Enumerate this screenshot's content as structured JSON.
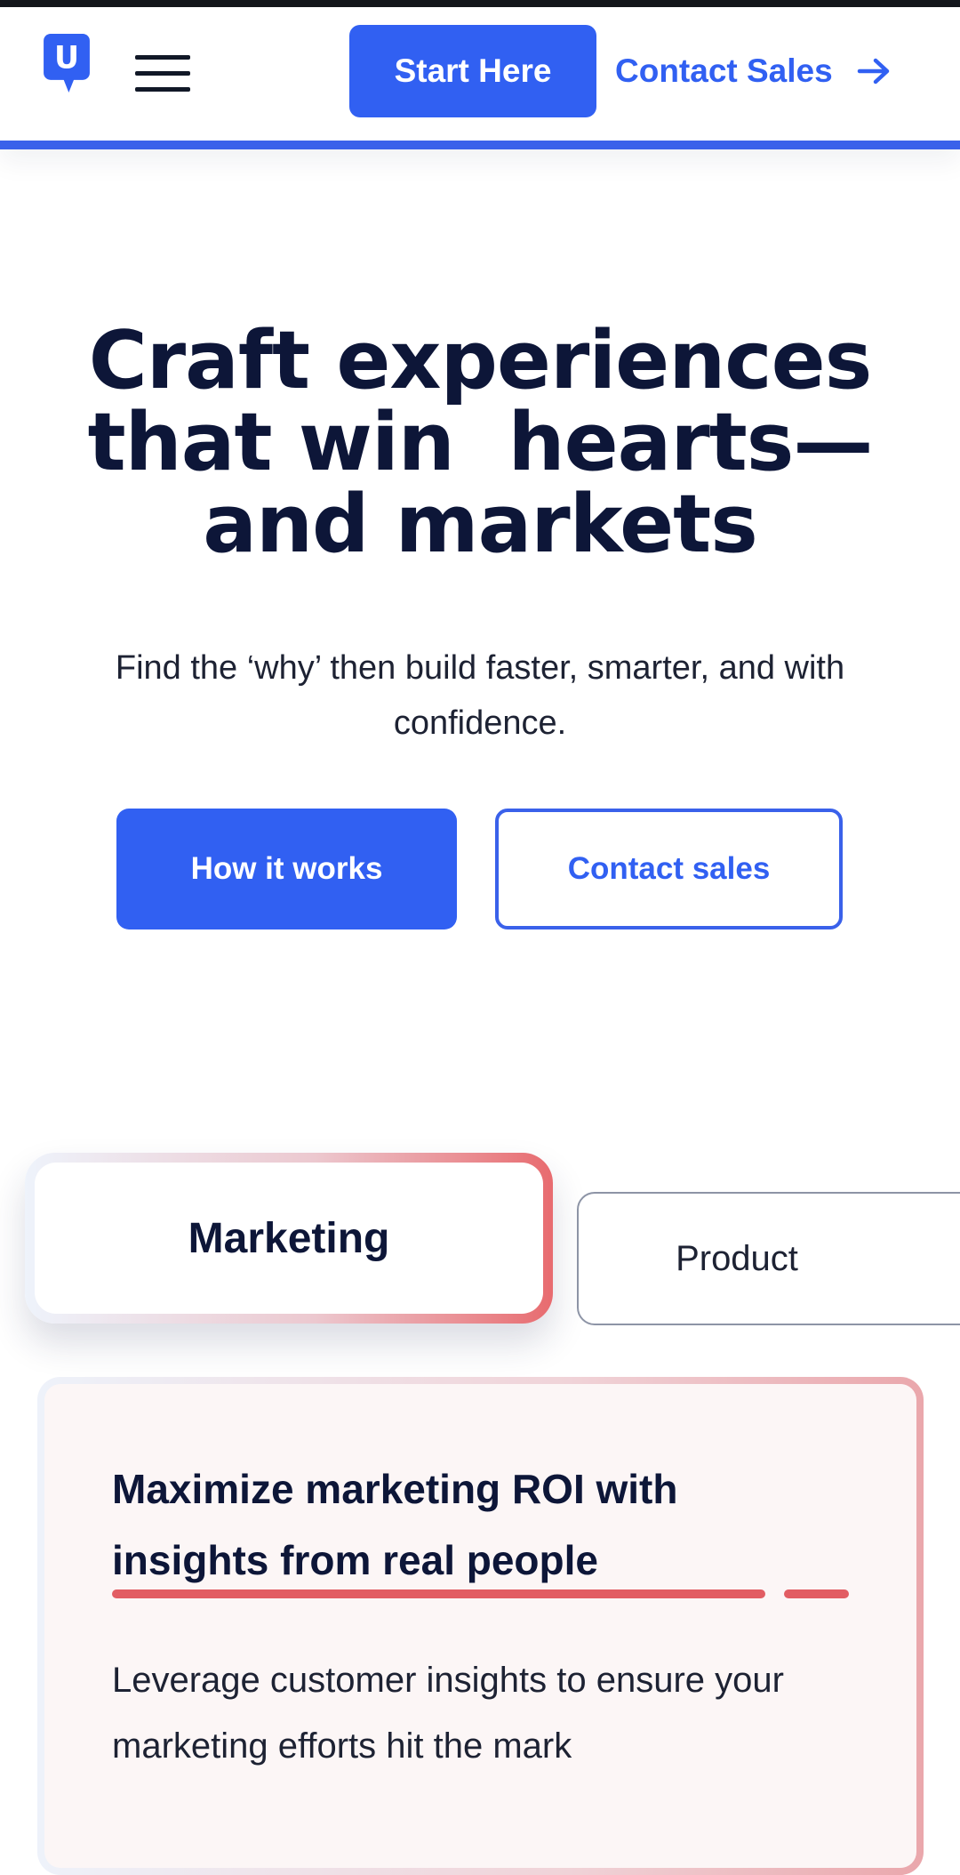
{
  "navbar": {
    "logo_letter": "U",
    "start_label": "Start Here",
    "contact_label": "Contact Sales"
  },
  "hero": {
    "title_lines": [
      "Craft experiences",
      "that win  hearts—",
      "and markets"
    ],
    "subtitle": "Find the ‘why’ then build faster, smarter, and with confidence.",
    "primary_button": "How it works",
    "secondary_button": "Contact sales"
  },
  "tabs": [
    {
      "label": "Marketing",
      "selected": true
    },
    {
      "label": "Product",
      "selected": false
    }
  ],
  "card": {
    "title": "Maximize marketing ROI with insights from real people",
    "body": "Leverage customer insights to ensure your marketing efforts hit the mark"
  },
  "colors": {
    "brand_blue": "#3160f2",
    "navy_text": "#0d1638",
    "accent_red": "#e25d63",
    "card_bg": "#fcf6f6"
  },
  "icons": {
    "logo": "brand-logo-icon",
    "menu": "hamburger-menu-icon",
    "arrow": "arrow-right-icon"
  }
}
